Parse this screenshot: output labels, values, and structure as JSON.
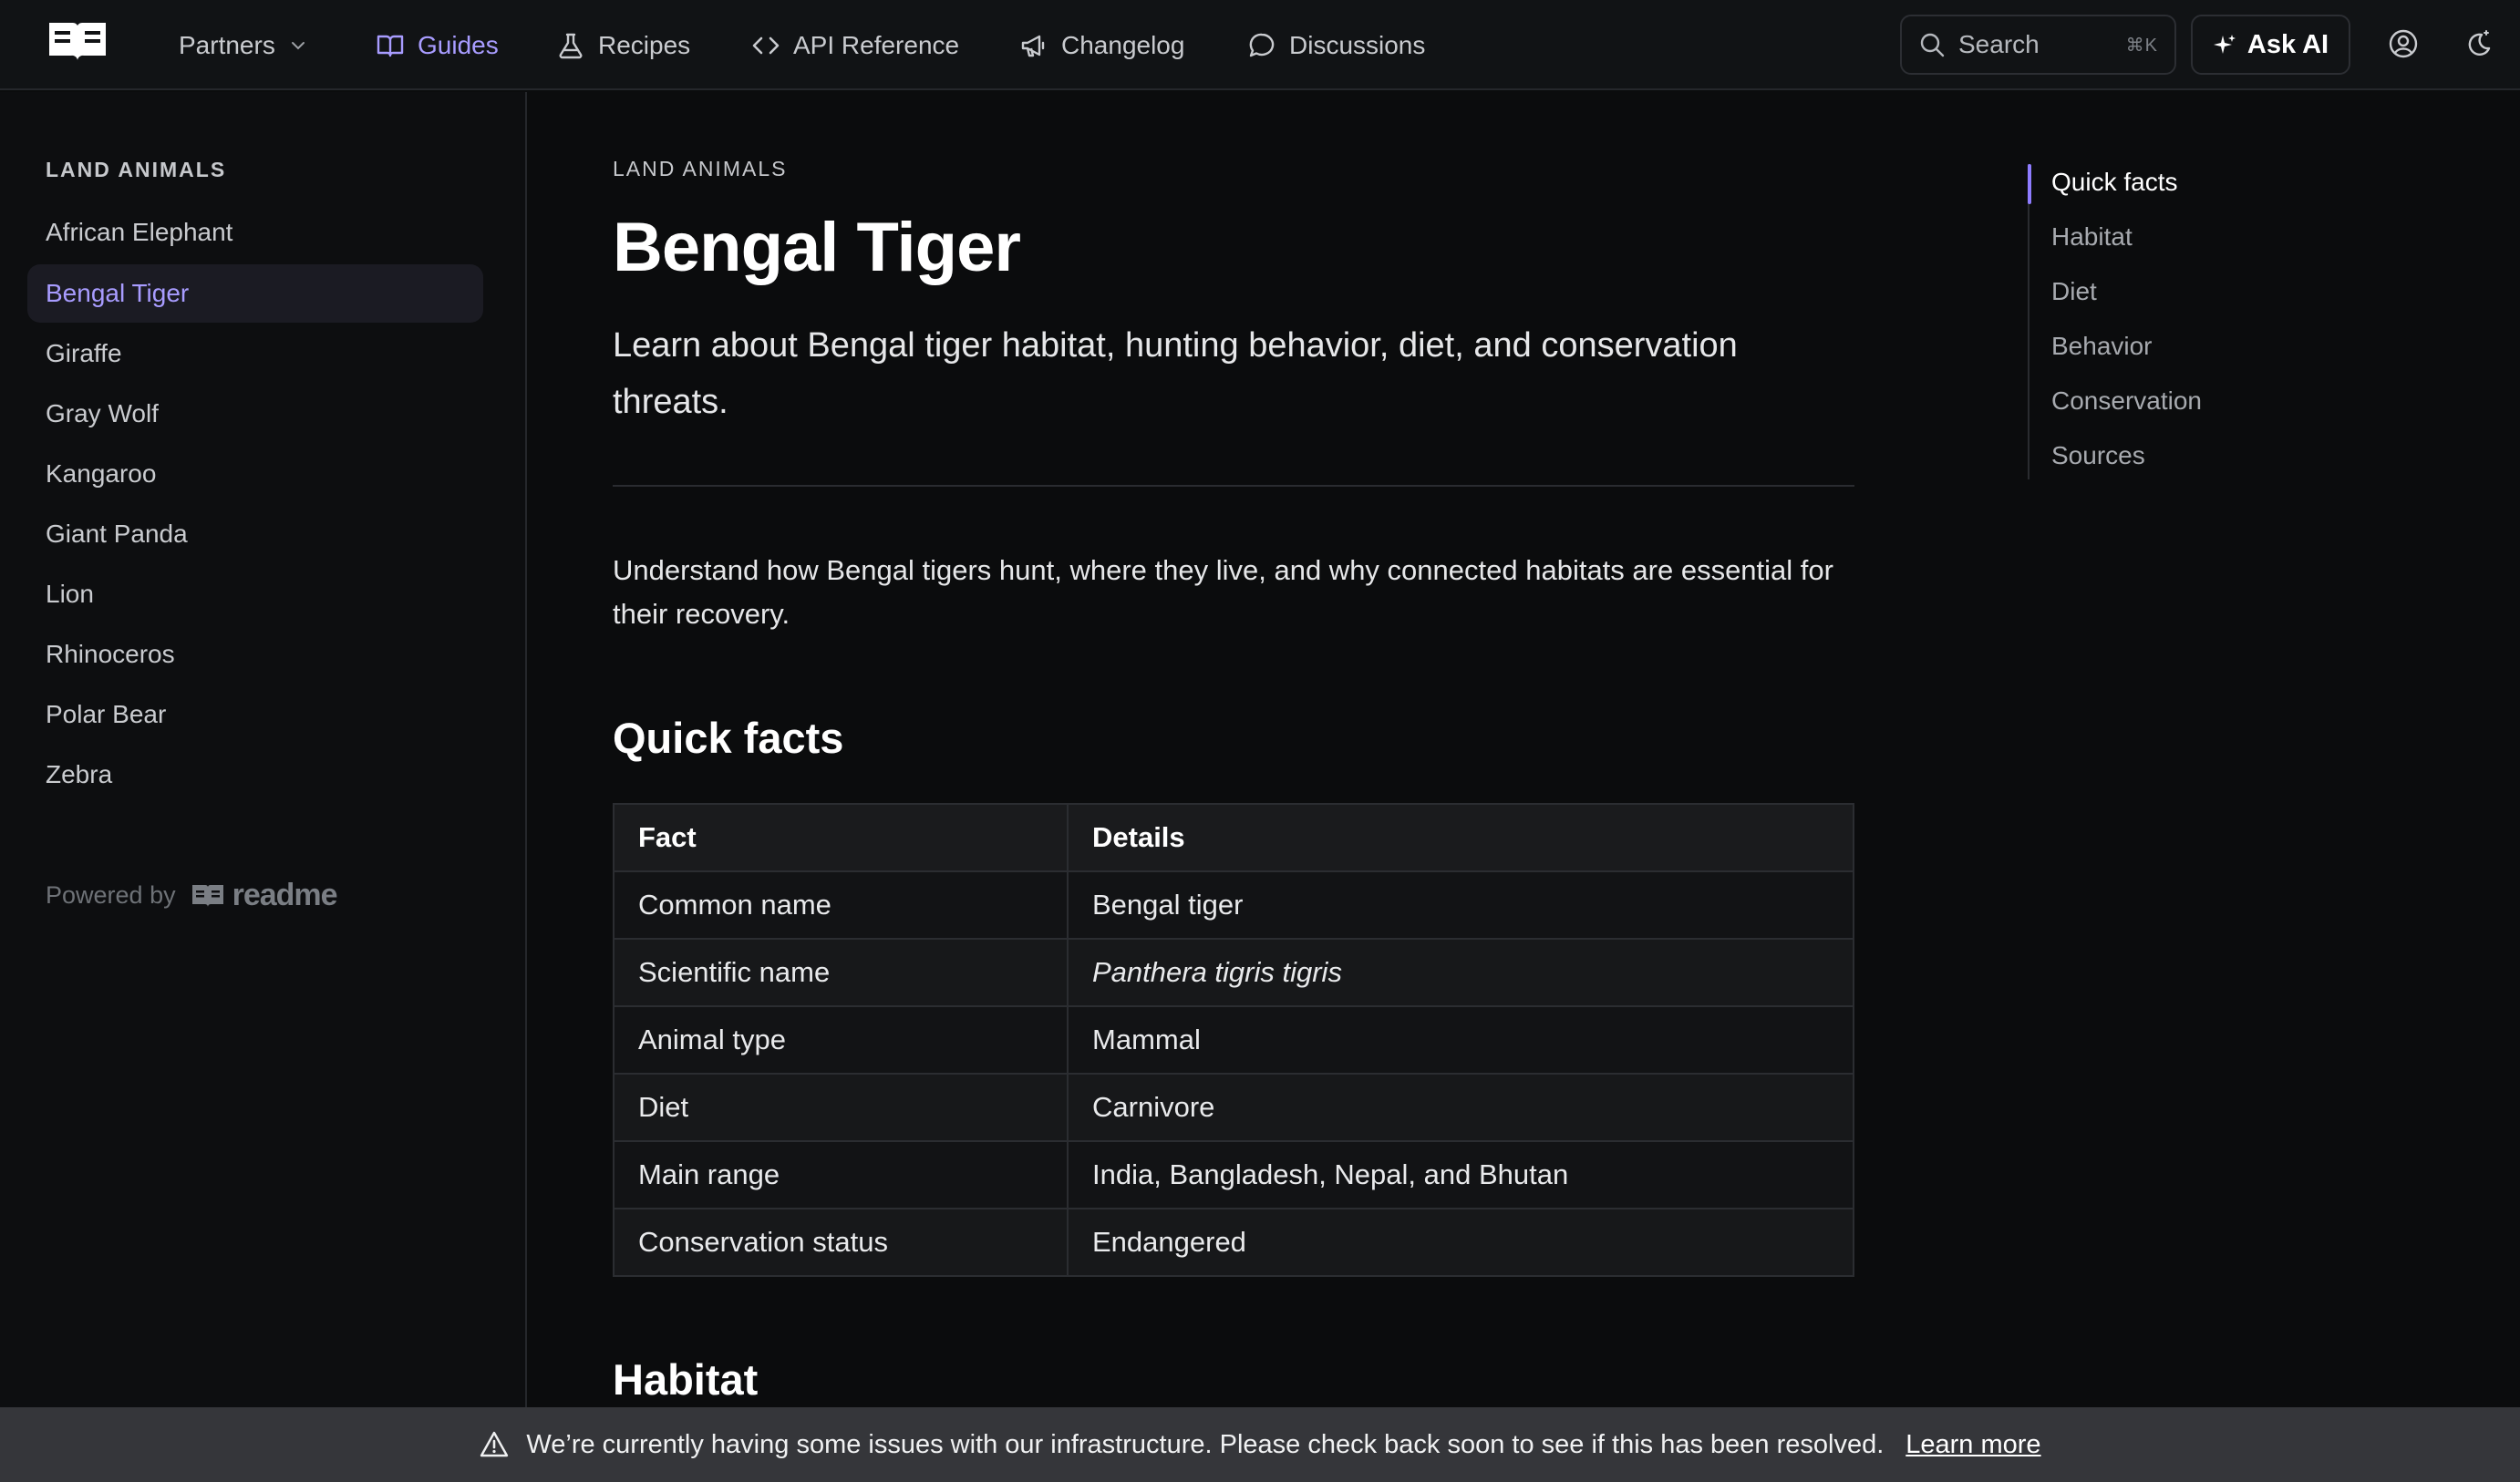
{
  "nav": {
    "items": [
      {
        "label": "Partners",
        "icon": "chevron-down-icon"
      },
      {
        "label": "Guides",
        "icon": "book-icon",
        "active": true
      },
      {
        "label": "Recipes",
        "icon": "flask-icon"
      },
      {
        "label": "API Reference",
        "icon": "code-icon"
      },
      {
        "label": "Changelog",
        "icon": "megaphone-icon"
      },
      {
        "label": "Discussions",
        "icon": "chat-bubble-icon"
      }
    ],
    "search_label": "Search",
    "search_shortcut": "⌘K",
    "ask_ai_label": "Ask AI"
  },
  "sidebar": {
    "heading": "LAND ANIMALS",
    "items": [
      {
        "label": "African Elephant"
      },
      {
        "label": "Bengal Tiger",
        "active": true
      },
      {
        "label": "Giraffe"
      },
      {
        "label": "Gray Wolf"
      },
      {
        "label": "Kangaroo"
      },
      {
        "label": "Giant Panda"
      },
      {
        "label": "Lion"
      },
      {
        "label": "Rhinoceros"
      },
      {
        "label": "Polar Bear"
      },
      {
        "label": "Zebra"
      }
    ],
    "powered_by": "Powered by",
    "powered_brand": "readme"
  },
  "main": {
    "eyebrow": "LAND ANIMALS",
    "title": "Bengal Tiger",
    "subtitle": "Learn about Bengal tiger habitat, hunting behavior, diet, and conservation threats.",
    "intro": "Understand how Bengal tigers hunt, where they live, and why connected habitats are essential for their recovery.",
    "quick_facts_heading": "Quick facts",
    "table": {
      "headers": [
        "Fact",
        "Details"
      ],
      "rows": [
        [
          "Common name",
          "Bengal tiger"
        ],
        [
          "Scientific name",
          "Panthera tigris tigris"
        ],
        [
          "Animal type",
          "Mammal"
        ],
        [
          "Diet",
          "Carnivore"
        ],
        [
          "Main range",
          "India, Bangladesh, Nepal, and Bhutan"
        ],
        [
          "Conservation status",
          "Endangered"
        ]
      ]
    },
    "habitat_heading": "Habitat"
  },
  "toc": {
    "items": [
      "Quick facts",
      "Habitat",
      "Diet",
      "Behavior",
      "Conservation",
      "Sources"
    ]
  },
  "banner": {
    "message": "We’re currently having some issues with our infrastructure. Please check back soon to see if this has been resolved.",
    "link_label": "Learn more"
  },
  "colors": {
    "accent": "#a89cff",
    "background": "#0b0c0d",
    "banner": "#35363a"
  }
}
